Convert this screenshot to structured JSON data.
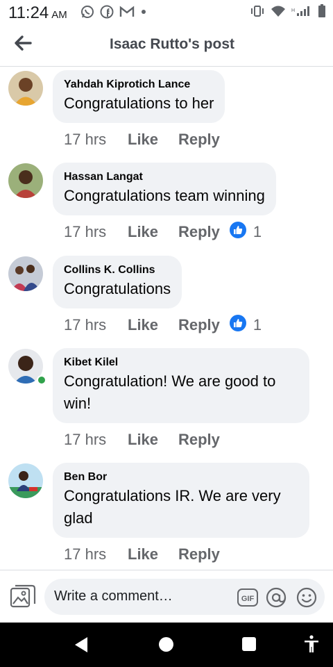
{
  "status_bar": {
    "time": "11:24",
    "ampm": "AM",
    "left_icons": [
      "whatsapp-icon",
      "facebook-icon",
      "gmail-icon",
      "dot-icon"
    ],
    "right_icons": [
      "vibrate-icon",
      "wifi-icon",
      "signal-icon",
      "battery-icon"
    ]
  },
  "header": {
    "title": "Isaac Rutto's post",
    "back_icon": "back-arrow-icon"
  },
  "comments": [
    {
      "author": "Yahdah Kiprotich Lance",
      "text": "Congratulations to her",
      "time": "17 hrs",
      "like": "Like",
      "reply": "Reply",
      "reactions": ""
    },
    {
      "author": "Hassan Langat",
      "text": "Congratulations team winning",
      "time": "17 hrs",
      "like": "Like",
      "reply": "Reply",
      "reactions": "1"
    },
    {
      "author": "Collins K. Collins",
      "text": "Congratulations",
      "time": "17 hrs",
      "like": "Like",
      "reply": "Reply",
      "reactions": "1"
    },
    {
      "author": "Kibet Kilel",
      "text": "Congratulation! We are good to win!",
      "time": "17 hrs",
      "like": "Like",
      "reply": "Reply",
      "reactions": "",
      "online": true
    },
    {
      "author": "Ben Bor",
      "text": "Congratulations IR. We are very glad",
      "time": "17 hrs",
      "like": "Like",
      "reply": "Reply",
      "reactions": ""
    }
  ],
  "composer": {
    "placeholder": "Write a comment…",
    "icons": [
      "photo-icon",
      "gif-icon",
      "mention-icon",
      "emoji-icon"
    ]
  },
  "nav_bar": {
    "icons": [
      "nav-back-icon",
      "nav-home-icon",
      "nav-recents-icon",
      "accessibility-icon"
    ]
  },
  "colors": {
    "bubble": "#f0f2f5",
    "secondary_text": "#65676b",
    "like_reaction": "#1877f2",
    "online": "#31a24c"
  }
}
